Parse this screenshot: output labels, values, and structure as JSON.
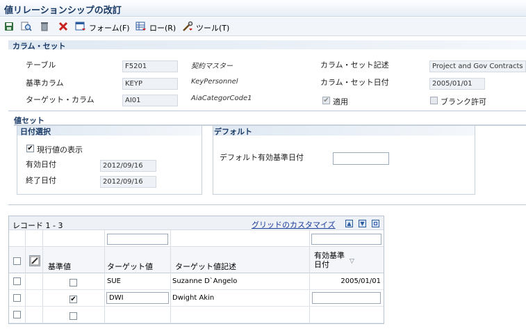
{
  "title": "値リレーションシップの改訂",
  "toolbar": {
    "form_label": "フォーム(F)",
    "row_label": "ロー(R)",
    "tools_label": "ツール(T)"
  },
  "column_set": {
    "section_title": "カラム・セット",
    "table_label": "テーブル",
    "table_value": "F5201",
    "contract_master_label": "契約マスター",
    "base_column_label": "基準カラム",
    "base_column_value": "KEYP",
    "base_column_desc": "KeyPersonnel",
    "target_column_label": "ターゲット・カラム",
    "target_column_value": "AI01",
    "target_column_desc": "AiaCategorCode1",
    "desc_label": "カラム・セット記述",
    "desc_value": "Project and Gov Contracts",
    "date_label": "カラム・セット日付",
    "date_value": "2005/01/01",
    "apply_label": "適用",
    "apply_checked": true,
    "allow_blank_label": "ブランク許可",
    "allow_blank_checked": false
  },
  "value_set": {
    "section_title": "値セット",
    "date_select_title": "日付選択",
    "show_current_label": "現行値の表示",
    "show_current_checked": true,
    "effective_date_label": "有効日付",
    "effective_date_value": "2012/09/16",
    "end_date_label": "終了日付",
    "end_date_value": "2012/09/16",
    "default_title": "デフォルト",
    "default_date_label": "デフォルト有効基準日付",
    "default_date_value": ""
  },
  "grid": {
    "record_label": "レコード 1 - 3",
    "customize_link": "グリッドのカスタマイズ",
    "columns": [
      "基準値",
      "ターゲット値",
      "ターゲット値記述",
      "有効基準日付"
    ],
    "rows": [
      {
        "base_checked": false,
        "target": "SUE",
        "description": "Suzanne D`Angelo",
        "date": "2005/01/01",
        "editable": false
      },
      {
        "base_checked": true,
        "target": "DWI",
        "description": "Dwight Akin",
        "date": "",
        "editable": true
      },
      {
        "base_checked": false,
        "target": "",
        "description": "",
        "date": "",
        "editable": false
      }
    ]
  }
}
